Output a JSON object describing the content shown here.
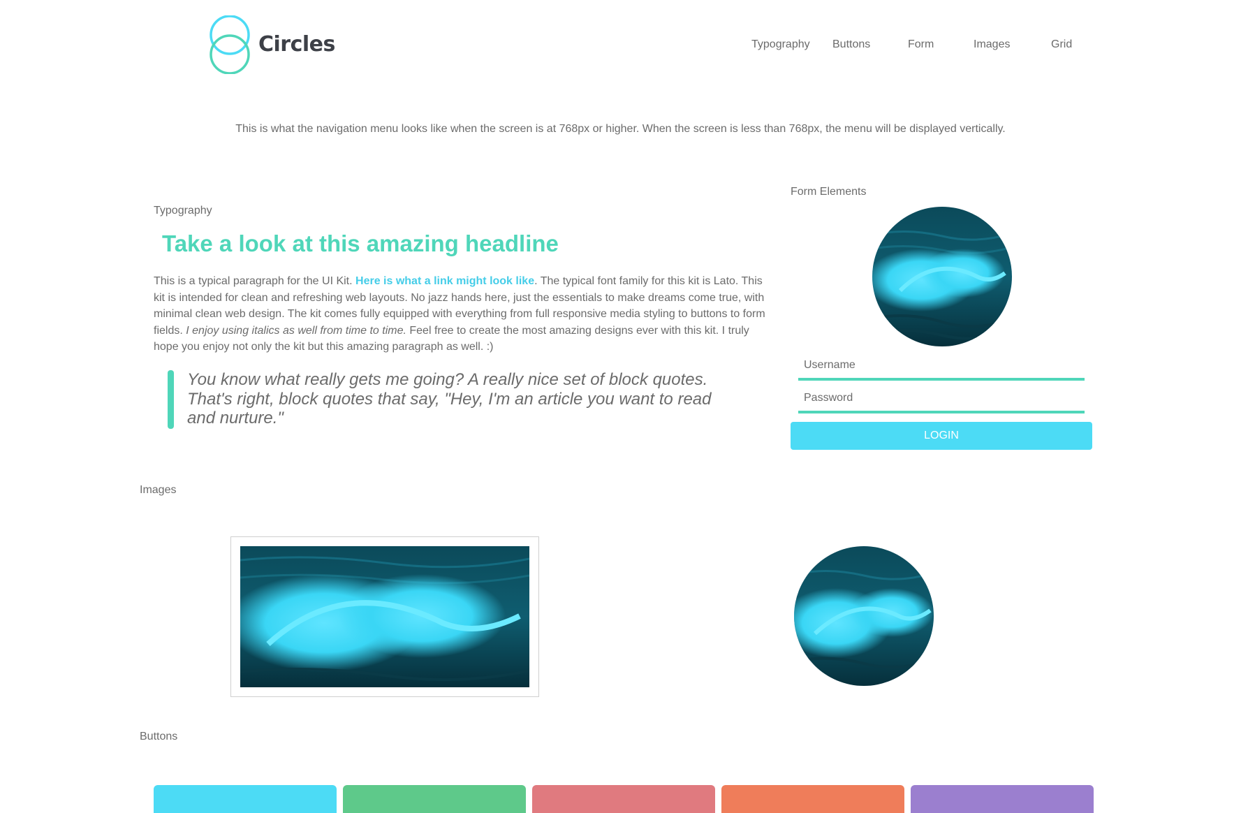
{
  "header": {
    "brand": "Circles",
    "nav": [
      {
        "label": "Typography"
      },
      {
        "label": "Buttons"
      },
      {
        "label": "Form"
      },
      {
        "label": "Images"
      },
      {
        "label": "Grid"
      }
    ]
  },
  "nav_note": "This is what the navigation menu looks like when the screen is at 768px or higher. When the screen is less than 768px, the menu will be displayed vertically.",
  "typography": {
    "label": "Typography",
    "headline": "Take a look at this amazing headline",
    "paragraph": {
      "part1": "This is a typical paragraph for the UI Kit. ",
      "link": "Here is what a link might look like",
      "part2": ". The typical font family for this kit is Lato. This kit is intended for clean and refreshing web layouts. No jazz hands here, just the essentials to make dreams come true, with minimal clean web design. The kit comes fully equipped with everything from full responsive media styling to buttons to form fields. ",
      "italic": "I enjoy using italics as well from time to time.",
      "part3": " Feel free to create the most amazing designs ever with this kit. I truly hope you enjoy not only the kit but this amazing paragraph as well. :)"
    },
    "blockquote": "You know what really gets me going? A really nice set of block quotes. That's right, block quotes that say, \"Hey, I'm an article you want to read and nurture.\""
  },
  "form": {
    "label": "Form Elements",
    "username_placeholder": "Username",
    "password_placeholder": "Password",
    "login_label": "LOGIN"
  },
  "images": {
    "label": "Images"
  },
  "buttons": {
    "label": "Buttons",
    "colors": [
      "#4cdbf5",
      "#5ec98a",
      "#e07a7f",
      "#ef7d5a",
      "#9b7fcf"
    ]
  },
  "colors": {
    "accent_teal": "#4fd6b9",
    "accent_cyan": "#4cdbf5",
    "link": "#45cde8"
  }
}
